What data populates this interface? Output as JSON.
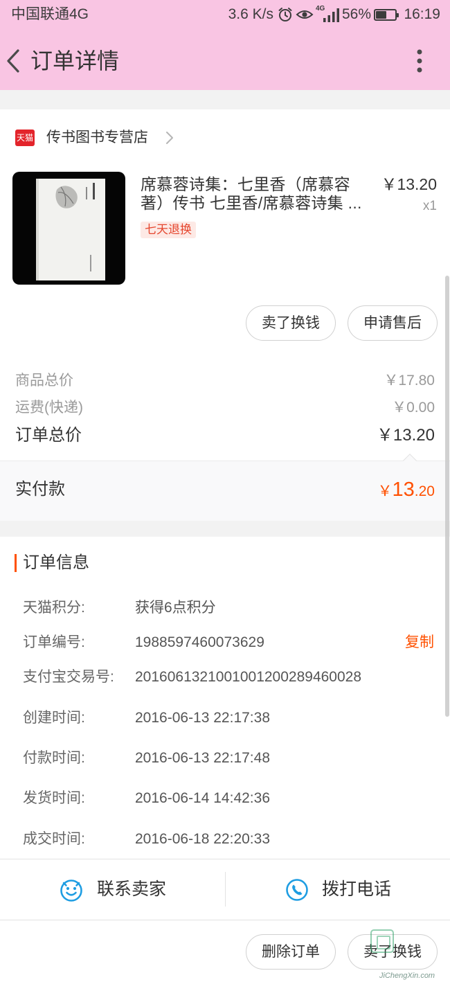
{
  "colors": {
    "header_bg": "#f9c5e3",
    "accent": "#ff5000",
    "tmall_red": "#e3242b",
    "icon_blue": "#1e9de2"
  },
  "status_bar": {
    "carrier": "中国联通4G",
    "speed": "3.6 K/s",
    "network": "4G",
    "battery": "56%",
    "battery_level": 56,
    "time": "16:19",
    "icons": [
      "alarm-clock-icon",
      "eye-icon",
      "signal-icon",
      "battery-icon"
    ]
  },
  "header": {
    "title": "订单详情",
    "back_icon": "chevron-left-icon",
    "menu_icon": "more-vertical-icon"
  },
  "store": {
    "badge": "天猫",
    "name": "传书图书专营店",
    "icon": "chevron-right-icon"
  },
  "product": {
    "title_lines": [
      "席慕蓉诗集：七里香（席慕容",
      "著）传书 七里香/席慕蓉诗集 ..."
    ],
    "price": "￥13.20",
    "quantity": "x1",
    "tag": "七天退换",
    "actions": [
      "卖了换钱",
      "申请售后"
    ]
  },
  "summary": {
    "rows": [
      {
        "label": "商品总价",
        "value": "￥17.80"
      },
      {
        "label": "运费(快递)",
        "value": "￥0.00"
      }
    ],
    "total": {
      "label": "订单总价",
      "value": "￥13.20"
    },
    "paid": {
      "label": "实付款",
      "currency": "￥",
      "integer": "13",
      "decimal": ".20"
    }
  },
  "order_info": {
    "heading": "订单信息",
    "copy_label": "复制",
    "rows": [
      {
        "label": "天猫积分:",
        "value": "获得6点积分"
      },
      {
        "label": "订单编号:",
        "value": "1988597460073629"
      },
      {
        "label": "支付宝交易号:",
        "value": "2016061321001001200289460028"
      },
      {
        "label": "创建时间:",
        "value": "2016-06-13 22:17:38"
      },
      {
        "label": "付款时间:",
        "value": "2016-06-13 22:17:48"
      },
      {
        "label": "发货时间:",
        "value": "2016-06-14 14:42:36"
      },
      {
        "label": "成交时间:",
        "value": "2016-06-18 22:20:33"
      }
    ]
  },
  "contact_bar": {
    "seller_label": "联系卖家",
    "seller_icon": "chat-smile-icon",
    "call_label": "拨打电话",
    "call_icon": "phone-icon"
  },
  "bottom_actions": [
    "删除订单",
    "卖了换钱"
  ],
  "watermark": "JiChengXin.com"
}
